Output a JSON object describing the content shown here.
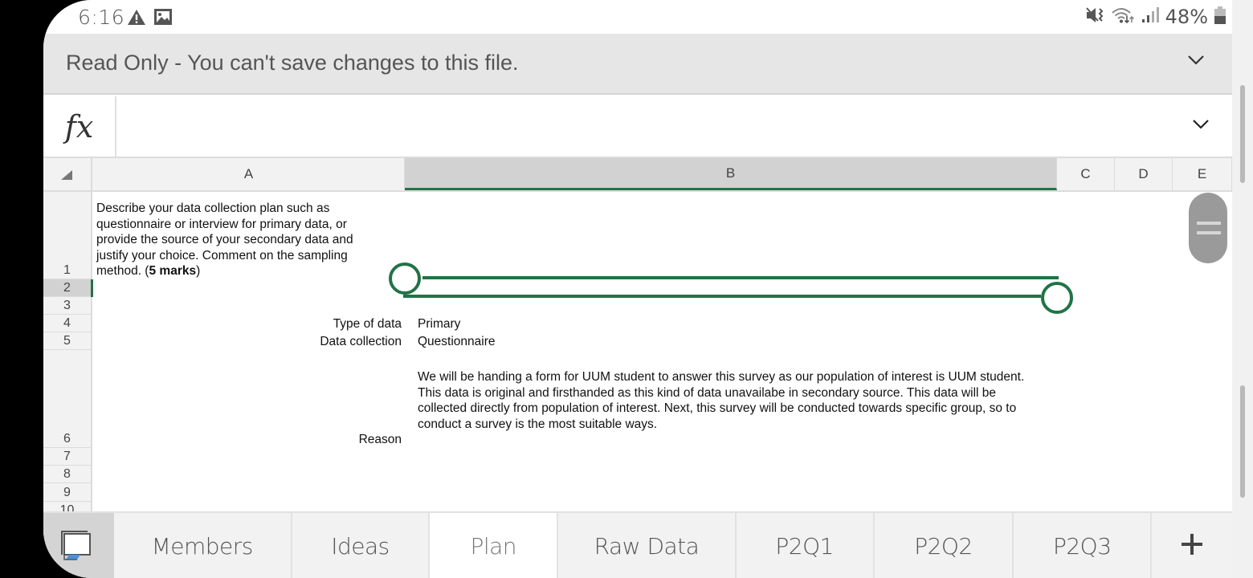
{
  "status_bar": {
    "time": "6:16",
    "left_icons": [
      "warning-icon",
      "image-icon"
    ],
    "right_icons": [
      "mute-vibrate-icon",
      "wifi-icon",
      "signal-icon",
      "battery-icon"
    ],
    "battery_percent": "48%"
  },
  "banner": {
    "text": "Read Only - You can't save changes to this file."
  },
  "formula_bar": {
    "fx_label": "fx",
    "value": ""
  },
  "columns": [
    "A",
    "B",
    "C",
    "D",
    "E"
  ],
  "selected_column": "B",
  "rows": [
    "1",
    "2",
    "3",
    "4",
    "5",
    "6",
    "7",
    "8",
    "9",
    "10"
  ],
  "selected_row": "2",
  "cells": {
    "A1_prefix": "Describe your data collection plan such as questionnaire or interview for primary data, or provide the source of your secondary data and justify your choice. Comment on the sampling method. (",
    "A1_bold": "5 marks",
    "A1_suffix": ")",
    "A4": "Type of data",
    "B4": "Primary",
    "A5": "Data collection",
    "B5": "Questionnaire",
    "A6": "Reason",
    "B6": "We will be handing a form for UUM student to answer this survey as our population of interest is UUM student. This data is original and firsthanded as this kind of data unavailabe in secondary source. This data will be collected directly from population of interest. Next, this survey will be conducted towards specific group, so to conduct a survey is the most suitable ways."
  },
  "sheet_tabs": [
    {
      "label": "Members",
      "active": false
    },
    {
      "label": "Ideas",
      "active": false
    },
    {
      "label": "Plan",
      "active": true
    },
    {
      "label": "Raw Data",
      "active": false
    },
    {
      "label": "P2Q1",
      "active": false
    },
    {
      "label": "P2Q2",
      "active": false
    },
    {
      "label": "P2Q3",
      "active": false
    }
  ],
  "add_sheet_label": "+",
  "colors": {
    "accent": "#217346",
    "header_bg": "#f2f2f2",
    "selected_header_bg": "#d2d2d2",
    "banner_bg": "#e6e6e6"
  }
}
